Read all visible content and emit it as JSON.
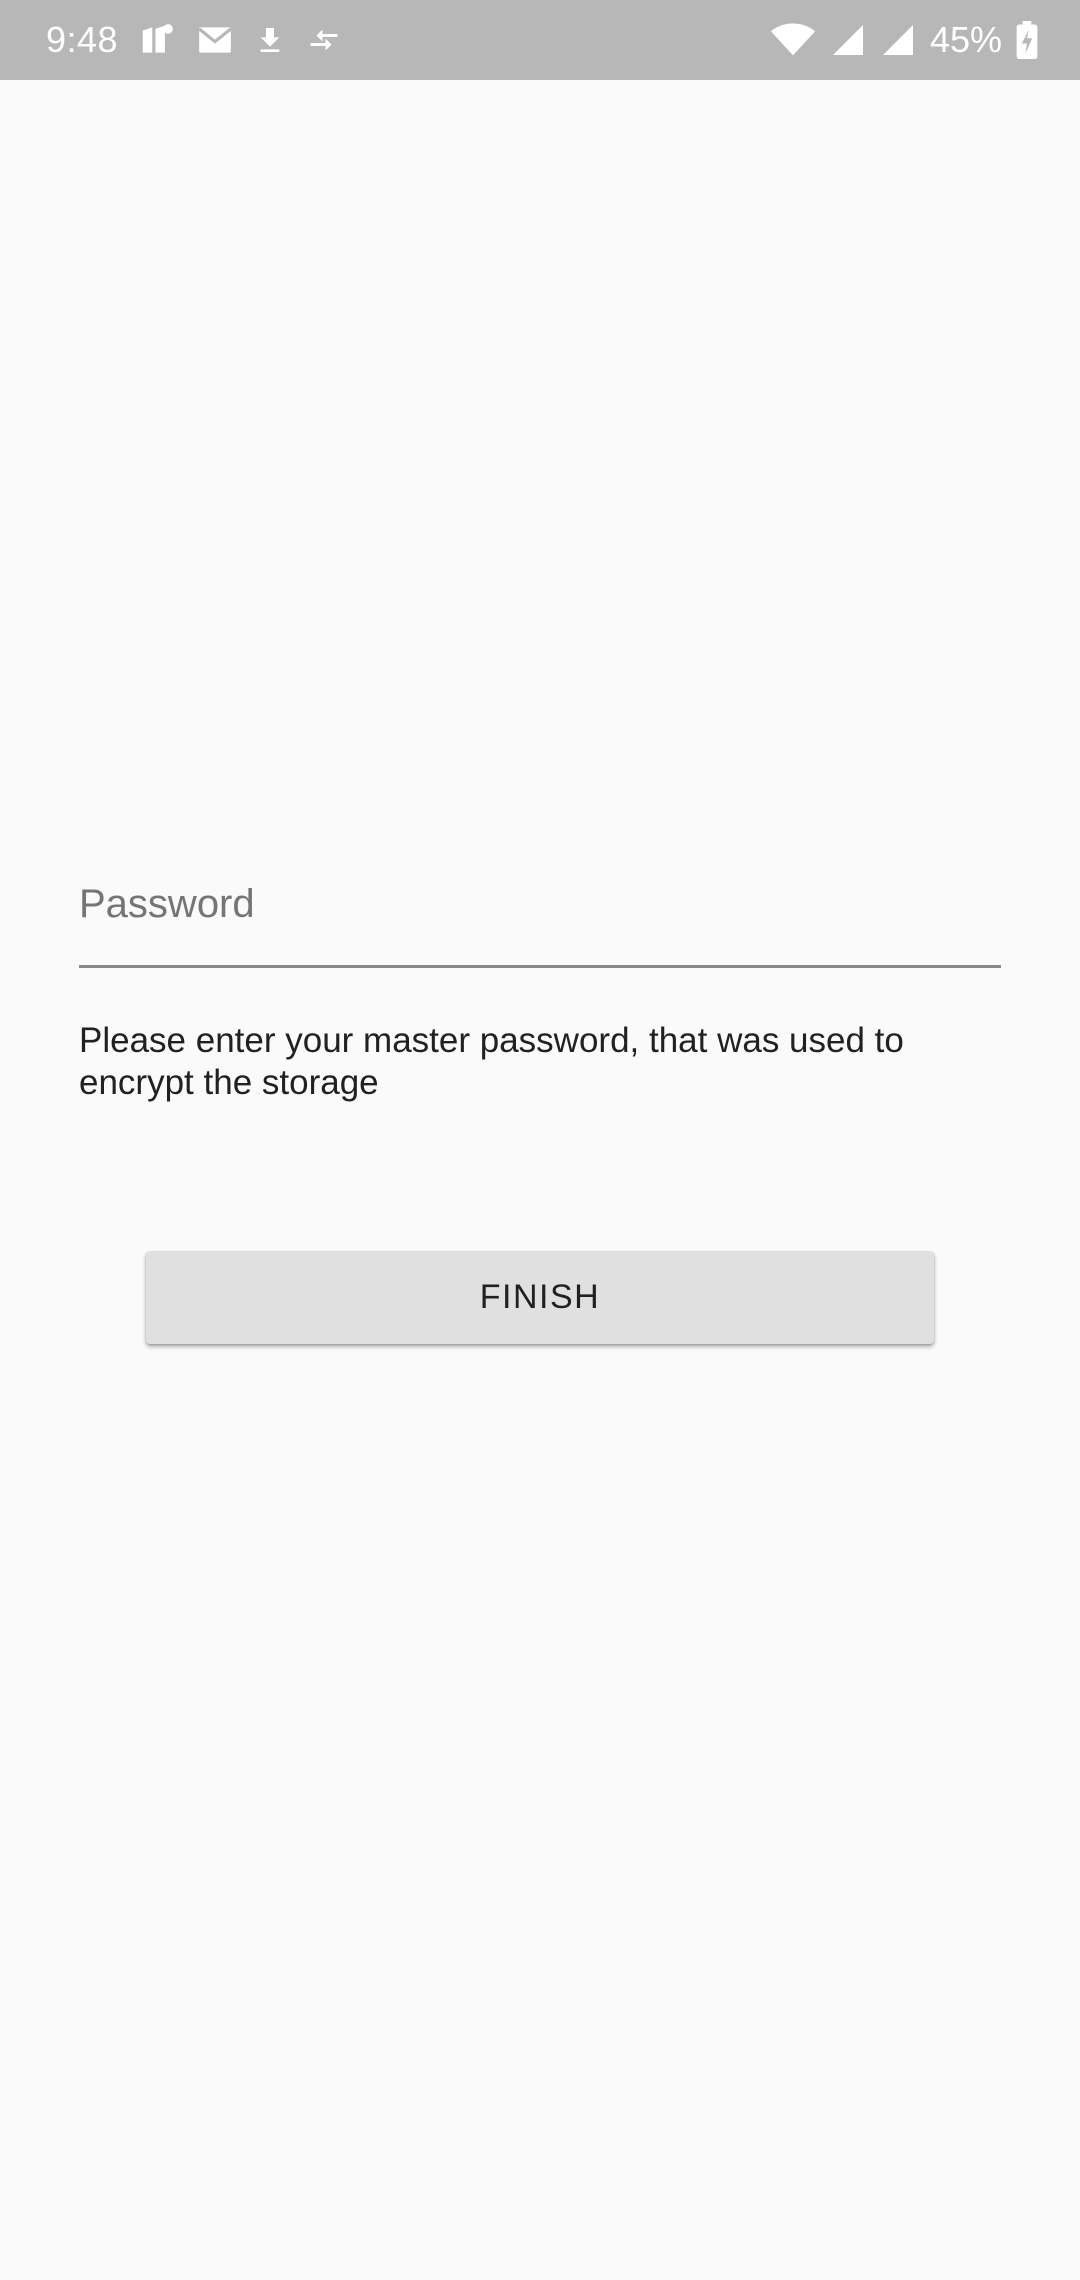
{
  "status_bar": {
    "time": "9:48",
    "battery_percent": "45%",
    "background_color": "#b7b7b7",
    "left_icons": [
      "notification-app-icon",
      "mail-icon",
      "download-icon",
      "data-transfer-icon"
    ],
    "right_icons": [
      "wifi-icon",
      "signal-icon",
      "signal-icon-2",
      "battery-charging-icon"
    ]
  },
  "form": {
    "password": {
      "value": "",
      "placeholder": "Password",
      "type": "password"
    },
    "helper_text": "Please enter your master password, that was used to encrypt the storage",
    "finish_label": "FINISH"
  },
  "colors": {
    "background": "#fafafa",
    "button_background": "#e0e0e0",
    "text_primary": "#212121",
    "placeholder": "#757575",
    "underline": "#8a8a8a"
  }
}
